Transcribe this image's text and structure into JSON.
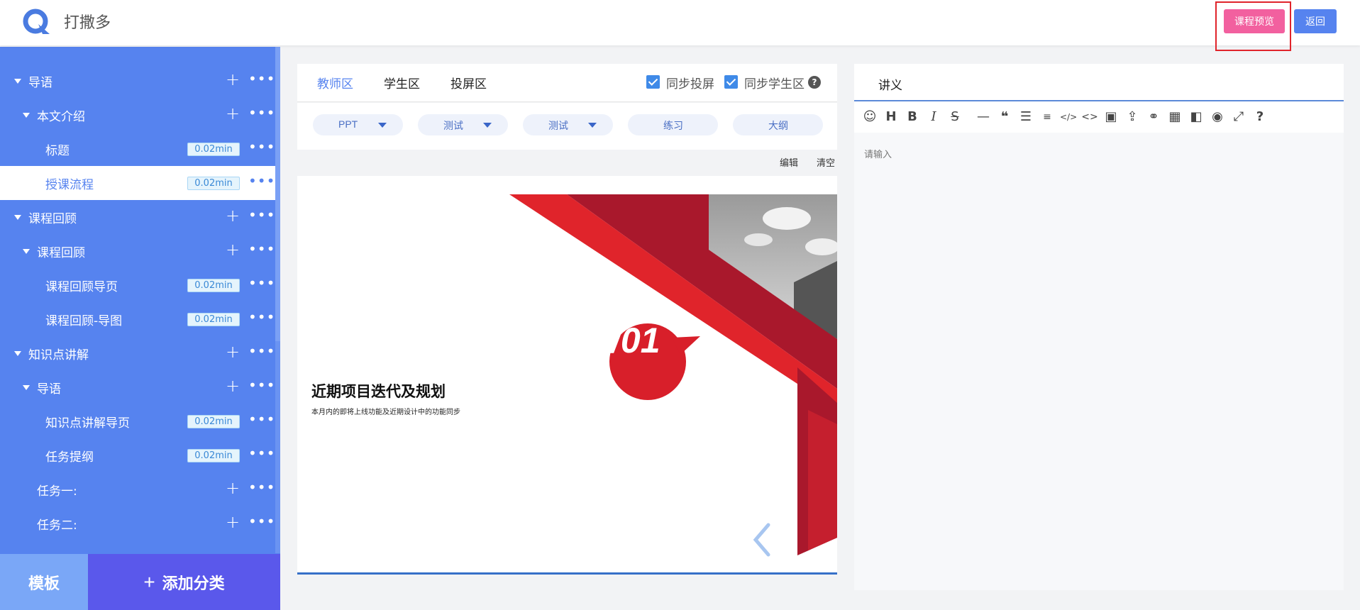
{
  "app": {
    "title": "打撒多"
  },
  "header": {
    "preview_label": "课程预览",
    "back_label": "返回"
  },
  "sidebar": {
    "items": [
      {
        "label": "导语",
        "duration": ""
      },
      {
        "label": "本文介绍",
        "duration": ""
      },
      {
        "label": "标题",
        "duration": "0.02min"
      },
      {
        "label": "授课流程",
        "duration": "0.02min"
      },
      {
        "label": "课程回顾",
        "duration": ""
      },
      {
        "label": "课程回顾",
        "duration": ""
      },
      {
        "label": "课程回顾导页",
        "duration": "0.02min"
      },
      {
        "label": "课程回顾-导图",
        "duration": "0.02min"
      },
      {
        "label": "知识点讲解",
        "duration": ""
      },
      {
        "label": "导语",
        "duration": ""
      },
      {
        "label": "知识点讲解导页",
        "duration": "0.02min"
      },
      {
        "label": "任务提纲",
        "duration": "0.02min"
      },
      {
        "label": "任务一:",
        "duration": ""
      },
      {
        "label": "任务二:",
        "duration": ""
      }
    ],
    "template_label": "模板",
    "add_category_label": "添加分类"
  },
  "mid": {
    "tabs": [
      "教师区",
      "学生区",
      "投屏区"
    ],
    "sync_screen_label": "同步投屏",
    "sync_student_label": "同步学生区",
    "help_glyph": "?",
    "toolbar": [
      "PPT",
      "测试",
      "测试",
      "练习",
      "大纲"
    ],
    "actions": {
      "edit": "编辑",
      "clear": "清空"
    },
    "slide": {
      "number": "/01",
      "title": "近期项目迭代及规划",
      "subtitle": "本月内的即将上线功能及近期设计中的功能同步"
    }
  },
  "right": {
    "title": "讲义",
    "placeholder": "请输入",
    "toolbar_icons": [
      "emoji-icon",
      "heading-icon",
      "bold-icon",
      "italic-icon",
      "strikethrough-icon",
      "horizontal-rule-icon",
      "quote-icon",
      "bullet-list-icon",
      "numbered-list-icon",
      "inline-code-icon",
      "code-block-icon",
      "image-icon",
      "upload-icon",
      "link-icon",
      "table-icon",
      "columns-icon",
      "preview-icon",
      "fullscreen-icon",
      "help-icon"
    ]
  },
  "colors": {
    "primary": "#5683ef",
    "preview_button": "#f2609f",
    "slide_red": "#e0242b"
  }
}
